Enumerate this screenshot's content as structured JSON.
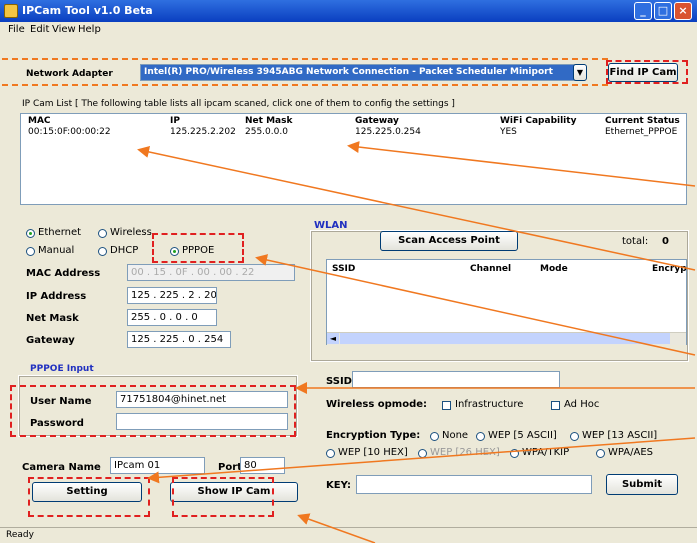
{
  "window": {
    "title": "IPCam Tool v1.0 Beta"
  },
  "menu": [
    "File",
    "Edit",
    "View",
    "Help"
  ],
  "network_adapter": {
    "label": "Network Adapter",
    "value": "Intel(R) PRO/Wireless 3945ABG Network Connection - Packet Scheduler Miniport",
    "find_button": "Find IP Cam"
  },
  "ipcam_list": {
    "caption": "IP Cam List [ The following table lists all ipcam scaned, click one of them to config the settings ]",
    "columns": [
      "MAC",
      "IP",
      "Net Mask",
      "Gateway",
      "WiFi Capability",
      "Current Status"
    ],
    "rows": [
      [
        "00:15:0F:00:00:22",
        "125.225.2.202",
        "255.0.0.0",
        "125.225.0.254",
        "YES",
        "Ethernet_PPPOE"
      ]
    ]
  },
  "connection": {
    "ethernet": "Ethernet",
    "wireless": "Wireless",
    "manual": "Manual",
    "dhcp": "DHCP",
    "pppoe": "PPPOE",
    "selected_type": "Ethernet",
    "selected_mode": "PPPOE"
  },
  "fields": {
    "mac_label": "MAC Address",
    "mac_value": "00 . 15 . 0F . 00 . 00 . 22",
    "ip_label": "IP Address",
    "ip_value": "125 . 225 . 2 . 202",
    "mask_label": "Net Mask",
    "mask_value": "255 . 0 . 0 . 0",
    "gw_label": "Gateway",
    "gw_value": "125 . 225 . 0 . 254"
  },
  "pppoe": {
    "title": "PPPOE Input",
    "user_label": "User Name",
    "user_value": "71751804@hinet.net",
    "pass_label": "Password",
    "pass_value": ""
  },
  "camera": {
    "name_label": "Camera Name",
    "name_value": "IPcam 01",
    "port_label": "Port",
    "port_value": "80",
    "setting_button": "Setting",
    "show_button": "Show IP Cam"
  },
  "wlan": {
    "title": "WLAN",
    "scan_button": "Scan Access Point",
    "total_label": "total:",
    "total_value": "0",
    "columns": [
      "SSID",
      "Channel",
      "Mode",
      "Encryp"
    ],
    "ssid_label": "SSID:",
    "ssid_value": "",
    "opmode_label": "Wireless opmode:",
    "infrastructure": "Infrastructure",
    "adhoc": "Ad Hoc",
    "enc_label": "Encryption Type:",
    "enc_none": "None",
    "enc_wep64a": "WEP [5 ASCII]",
    "enc_wep128a": "WEP [13 ASCII]",
    "enc_wep64h": "WEP [10 HEX]",
    "enc_wep128h": "WEP [26 HEX]",
    "enc_wpa": "WPA/TKIP",
    "enc_wpa2": "WPA/AES",
    "key_label": "KEY:",
    "key_value": "",
    "submit_button": "Submit"
  },
  "status": {
    "text": "Ready"
  },
  "colors": {
    "title_bar": "#0a3fc0",
    "annotation_red": "#e02020",
    "annotation_orange": "#f07820",
    "wlan_title": "#2030c0",
    "pppoe_title": "#2030c0"
  }
}
